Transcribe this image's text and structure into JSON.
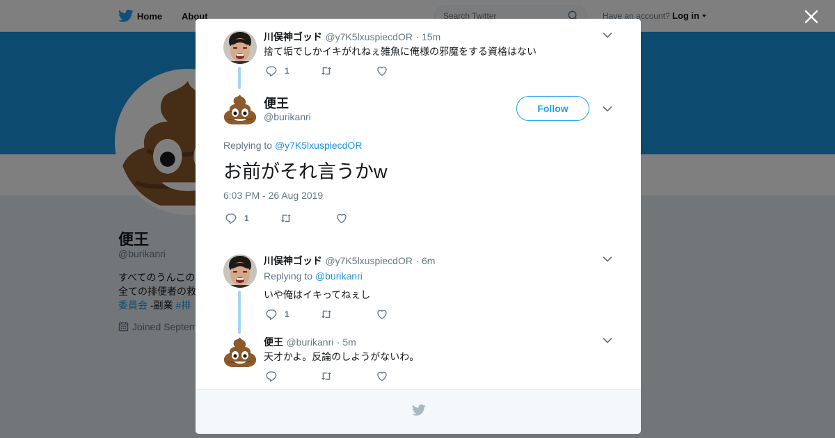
{
  "nav": {
    "home_label": "Home",
    "about_label": "About",
    "search_placeholder": "Search Twitter",
    "account_text": "Have an account?",
    "login_label": "Log in"
  },
  "profile": {
    "name": "便王",
    "handle": "@burikanri",
    "bio_line1": "すべてのうんこの",
    "bio_line2": "全ての排便者の救",
    "bio_line3_link": "委員会",
    "bio_line3_text": " -副業 ",
    "bio_line3_hashtag": "#排",
    "joined": "Joined Septem"
  },
  "modal": {
    "tweet1": {
      "name": "川俣神ゴッド",
      "handle": "@y7K5lxuspiecdOR",
      "time": "· 15m",
      "text": "捨て垢でしかイキがれねぇ雑魚に俺様の邪魔をする資格はない",
      "reply_count": "1"
    },
    "focus": {
      "name": "便王",
      "handle": "@burikanri",
      "follow_label": "Follow",
      "replying_prefix": "Replying to",
      "replying_to": "@y7K5lxuspiecdOR",
      "text": "お前がそれ言うかw",
      "timestamp": "6:03 PM - 26 Aug 2019",
      "reply_count": "1"
    },
    "tweet3": {
      "name": "川俣神ゴッド",
      "handle": "@y7K5lxuspiecdOR",
      "time": "· 6m",
      "replying_prefix": "Replying to",
      "replying_to": "@burikanri",
      "text": "いや俺はイキってねぇし",
      "reply_count": "1"
    },
    "tweet4": {
      "name": "便王",
      "handle": "@burikanri",
      "time": "· 5m",
      "text": "天才かよ。反論のしようがないわ。"
    }
  },
  "colors": {
    "accent": "#1da1f2",
    "banner": "#1b95e0",
    "thread_line": "#a6d5f2",
    "muted": "#657786"
  },
  "icons": [
    "twitter-bird-icon",
    "search-icon",
    "close-icon",
    "reply-icon",
    "retweet-icon",
    "like-icon",
    "chevron-down-icon",
    "calendar-icon",
    "poop-emoji-avatar"
  ]
}
